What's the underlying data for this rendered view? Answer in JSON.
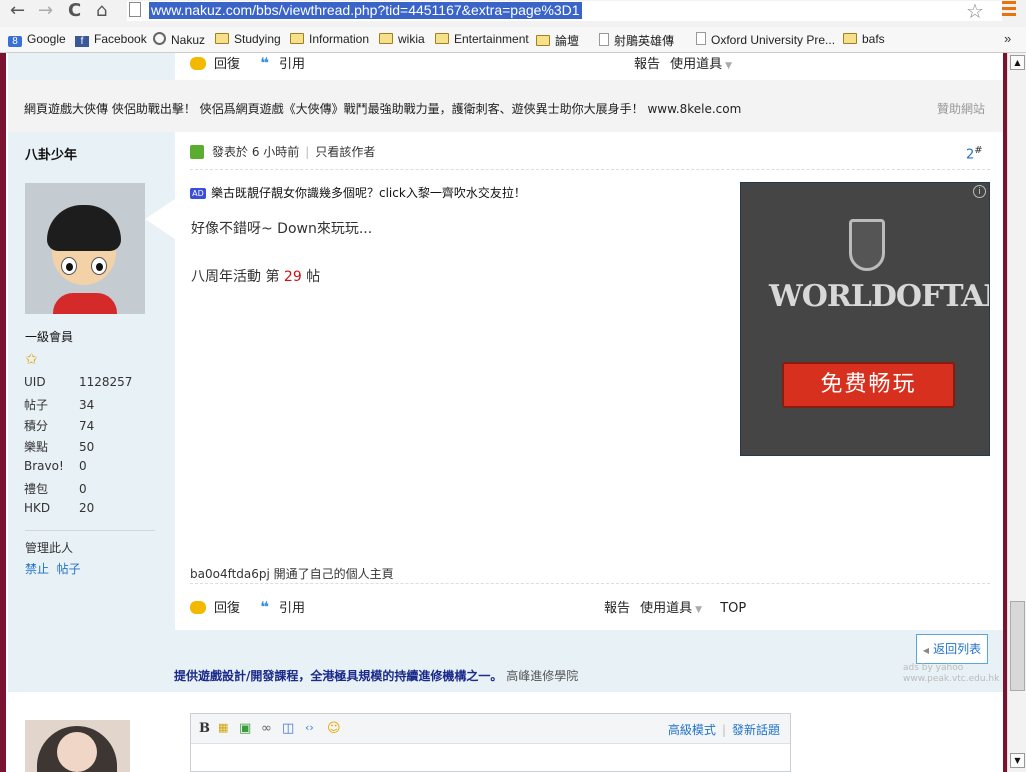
{
  "browser": {
    "url": "www.nakuz.com/bbs/viewthread.php?tid=4451167&extra=page%3D1",
    "bookmarks": [
      {
        "label": "Google",
        "icon": "google"
      },
      {
        "label": "Facebook",
        "icon": "facebook"
      },
      {
        "label": "Nakuz",
        "icon": "nakuz"
      },
      {
        "label": "Studying",
        "icon": "folder"
      },
      {
        "label": "Information",
        "icon": "folder"
      },
      {
        "label": "wikia",
        "icon": "folder"
      },
      {
        "label": "Entertainment",
        "icon": "folder"
      },
      {
        "label": "論壇",
        "icon": "folder"
      },
      {
        "label": "射鵰英雄傳",
        "icon": "page"
      },
      {
        "label": "Oxford University Pre...",
        "icon": "page"
      },
      {
        "label": "bafs",
        "icon": "folder"
      }
    ],
    "overflow": "»"
  },
  "top_actions": {
    "reply": "回復",
    "quote": "引用",
    "report": "報告",
    "tools": "使用道具"
  },
  "sponsor_bar": {
    "text": "網頁遊戲大俠傳 俠侶助戰出擊！ 俠侶爲網頁遊戲《大俠傳》戰鬥最強助戰力量，護衛刺客、遊俠異士助你大展身手！ www.8kele.com",
    "sponsor": "贊助網站"
  },
  "user": {
    "name": "八卦少年",
    "rank": "一級會員",
    "stats": [
      {
        "k": "UID",
        "v": "1128257"
      },
      {
        "k": "帖子",
        "v": "34"
      },
      {
        "k": "積分",
        "v": "74"
      },
      {
        "k": "樂點",
        "v": "50"
      },
      {
        "k": "Bravo!",
        "v": "0"
      },
      {
        "k": "禮包",
        "v": "0"
      },
      {
        "k": "HKD",
        "v": "20"
      }
    ],
    "manage_label": "管理此人",
    "ban": "禁止",
    "posts": "帖子"
  },
  "post": {
    "posted": "發表於 6 小時前",
    "only_author": "只看該作者",
    "number": "2",
    "number_suffix": "#",
    "ad_badge": "AD",
    "ad_text": "樂古既靚仔靚女你識幾多個呢？click入黎一齊吹水交友拉！",
    "line1": "好像不錯呀~ Down來玩玩...",
    "event_prefix": "八周年活動 第",
    "event_num": "29",
    "event_suffix": "帖",
    "syslog": "ba0o4ftda6pj 開通了自己的個人主頁"
  },
  "banner": {
    "logo": "WORLDOFTANKS",
    "button": "免费畅玩",
    "info": "i"
  },
  "bottom_actions": {
    "reply": "回復",
    "quote": "引用",
    "report": "報告",
    "tools": "使用道具",
    "top": "TOP"
  },
  "footer": {
    "back": "返回列表",
    "ad_link": "提供遊戲設計/開發課程，全港極具規模的持續進修機構之一。",
    "ad_tail": "高峰進修學院",
    "watermark1": "ads by yahoo",
    "watermark2": "www.peak.vtc.edu.hk"
  },
  "editor": {
    "advanced": "高級模式",
    "new_topic": "發新話題"
  }
}
